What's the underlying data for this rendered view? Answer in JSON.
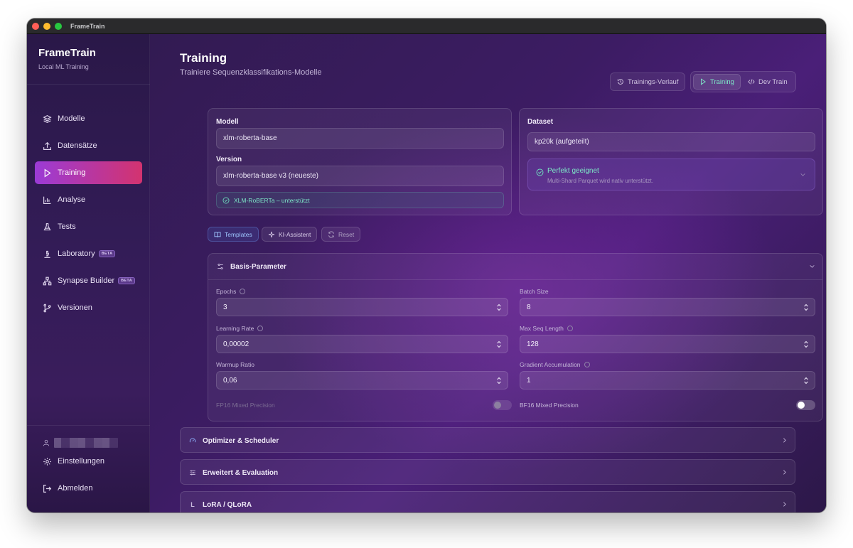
{
  "window": {
    "title": "FrameTrain"
  },
  "sidebar": {
    "brand": "FrameTrain",
    "subtitle": "Local ML Training",
    "items": [
      {
        "label": "Modelle",
        "icon": "layers-icon"
      },
      {
        "label": "Datensätze",
        "icon": "upload-icon"
      },
      {
        "label": "Training",
        "icon": "play-icon",
        "active": true
      },
      {
        "label": "Analyse",
        "icon": "bar-chart-icon"
      },
      {
        "label": "Tests",
        "icon": "flask-icon"
      },
      {
        "label": "Laboratory",
        "icon": "microscope-icon",
        "badge": "BETA"
      },
      {
        "label": "Synapse Builder",
        "icon": "network-icon",
        "badge": "BETA"
      },
      {
        "label": "Versionen",
        "icon": "git-branch-icon"
      }
    ],
    "settings": "Einstellungen",
    "logout": "Abmelden"
  },
  "header": {
    "title": "Training",
    "subtitle": "Trainiere Sequenzklassifikations-Modelle",
    "history_button": "Trainings-Verlauf",
    "tab_training": "Training",
    "tab_dev": "Dev Train"
  },
  "model_card": {
    "model_label": "Modell",
    "model_value": "xlm-roberta-base",
    "version_label": "Version",
    "version_value": "xlm-roberta-base v3 (neueste)",
    "support_text": "XLM-RoBERTa – unterstützt"
  },
  "dataset_card": {
    "label": "Dataset",
    "value": "kp20k (aufgeteilt)",
    "fit_title": "Perfekt geeignet",
    "fit_desc": "Multi-Shard Parquet wird nativ unterstützt."
  },
  "actions": {
    "templates": "Templates",
    "assistant": "KI-Assistent",
    "reset": "Reset"
  },
  "basis": {
    "title": "Basis-Parameter",
    "epochs_label": "Epochs",
    "epochs": "3",
    "batch_label": "Batch Size",
    "batch": "8",
    "lr_label": "Learning Rate",
    "lr": "0,00002",
    "seq_label": "Max Seq Length",
    "seq": "128",
    "warmup_label": "Warmup Ratio",
    "warmup": "0,06",
    "grad_label": "Gradient Accumulation",
    "grad": "1",
    "fp16_label": "FP16 Mixed Precision",
    "fp16_on": false,
    "bf16_label": "BF16 Mixed Precision",
    "bf16_on": false
  },
  "sections": {
    "optimizer": "Optimizer & Scheduler",
    "advanced": "Erweitert & Evaluation",
    "lora": "LoRA / QLoRA",
    "lora_icon_letter": "L"
  },
  "colors": {
    "accent_start": "#9b3bd6",
    "accent_end": "#d3336f",
    "success": "#7ee8c8"
  }
}
